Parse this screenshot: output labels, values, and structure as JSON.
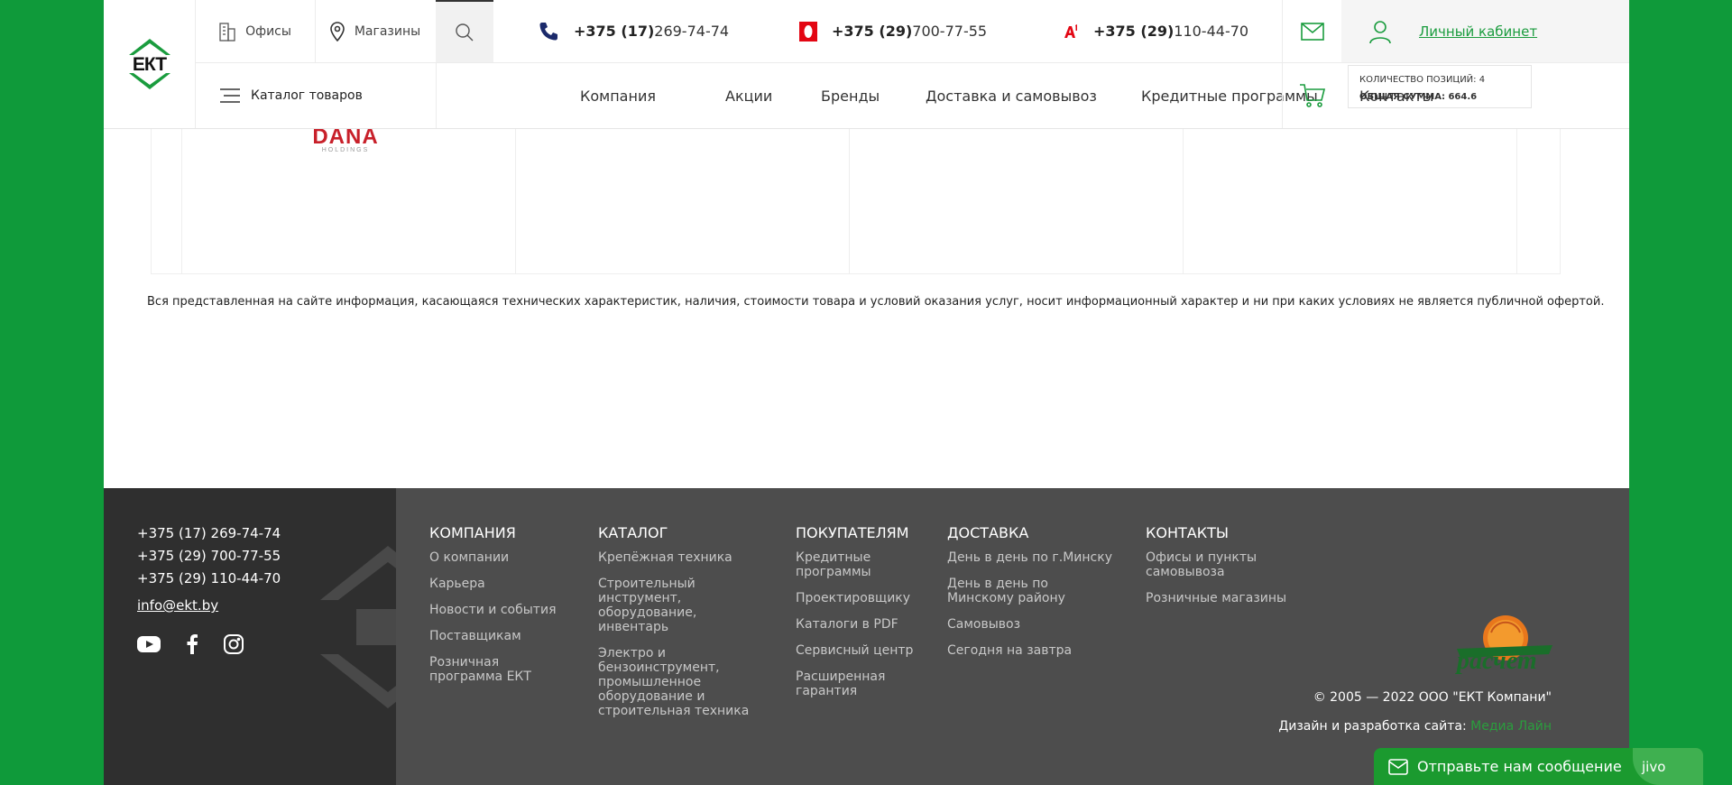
{
  "colors": {
    "accent": "#1a9c3e",
    "background": "#0f9a3a",
    "footer_dark": "#2f2f2f",
    "footer_main": "#4d4d4d"
  },
  "logo": {
    "text": "ЕКТ"
  },
  "header": {
    "offices_label": "Офисы",
    "shops_label": "Магазины",
    "phones": [
      {
        "code": "+375 (17)",
        "number": " 269-74-74",
        "icon": "landline-phone-icon"
      },
      {
        "code": "+375 (29)",
        "number": " 700-77-55",
        "icon": "mts-logo-icon"
      },
      {
        "code": "+375 (29)",
        "number": " 110-44-70",
        "icon": "a1-logo-icon"
      }
    ],
    "account_label": "Личный кабинет",
    "catalog_label": "Каталог товаров",
    "nav": [
      "Компания",
      "Акции",
      "Бренды",
      "Доставка и самовывоз",
      "Кредитные программы",
      "Контакты"
    ],
    "cart_count_label": "Количество позиций: 4",
    "cart_sum_label": "Общая сумма: 664.6"
  },
  "brands": {
    "dana_main": "DANA",
    "dana_sub": "HOLDINGS"
  },
  "disclaimer": "Вся представленная на сайте информация, касающаяся технических характеристик, наличия, стоимости товара и условий оказания услуг, носит информационный характер и ни при каких условиях не является публичной офертой.",
  "footer": {
    "phones": [
      "+375 (17) 269-74-74",
      "+375 (29) 700-77-55",
      "+375 (29) 110-44-70"
    ],
    "email": "info@ekt.by",
    "socials": [
      "youtube-icon",
      "facebook-icon",
      "instagram-icon"
    ],
    "columns": [
      {
        "title": "Компания",
        "links": [
          "О компании",
          "Карьера",
          "Новости и события",
          "Поставщикам",
          "Розничная\nпрограмма ЕКТ"
        ]
      },
      {
        "title": "Каталог",
        "links": [
          "Крепёжная техника",
          "Строительный\nинструмент,\nоборудование,\nинвентарь",
          "Электро и\nбензоинструмент,\nпромышленное\nоборудование и\nстроительная техника"
        ]
      },
      {
        "title": "Покупателям",
        "links": [
          "Кредитные\nпрограммы",
          "Проектировщику",
          "Каталоги в PDF",
          "Сервисный центр",
          "Расширенная\nгарантия"
        ]
      },
      {
        "title": "Доставка",
        "links": [
          "День в день по г.Минску",
          "День в день по\nМинскому району",
          "Самовывоз",
          "Сегодня на завтра"
        ]
      },
      {
        "title": "Контакты",
        "links": [
          "Офисы и пункты\nсамовывоза",
          "Розничные магазины"
        ]
      }
    ],
    "raschet_label": "расчет",
    "copyright": "© 2005 — 2022 ООО \"ЕКТ Компани\"",
    "dev_label": "Дизайн и разработка сайта:",
    "dev_link": "Медиа Лайн"
  },
  "jivo": {
    "label": "Отправьте нам сообщение",
    "brand": "jivo"
  }
}
